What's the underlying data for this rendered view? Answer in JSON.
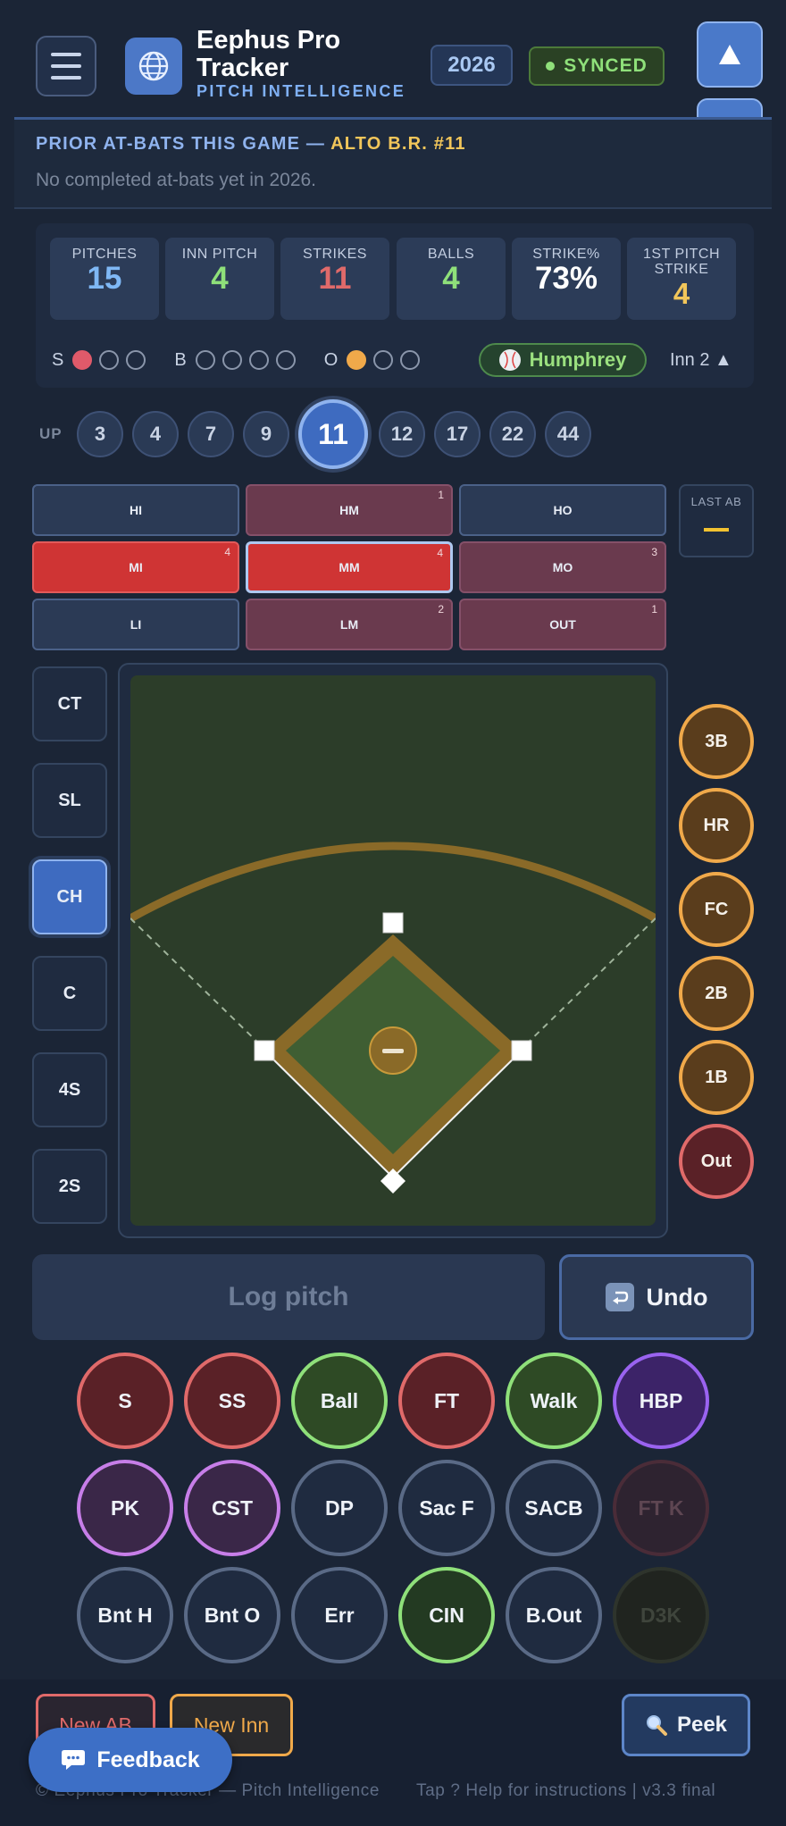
{
  "header": {
    "app_title": "Eephus Pro Tracker",
    "app_subtitle": "PITCH INTELLIGENCE",
    "year": "2026",
    "sync_status": "SYNCED",
    "icons": [
      "menu-icon",
      "globe-icon",
      "arrow-up-icon",
      "arrow-down-icon"
    ]
  },
  "prior": {
    "heading_prefix": "PRIOR AT-BATS THIS GAME —",
    "batter": "ALTO B.R. #11",
    "empty_message": "No completed at-bats yet in 2026."
  },
  "stats": [
    {
      "label": "PITCHES",
      "value": "15",
      "color": "#7fb8f5"
    },
    {
      "label": "INN PITCH",
      "value": "4",
      "color": "#8fe07a"
    },
    {
      "label": "STRIKES",
      "value": "11",
      "color": "#e06a6a"
    },
    {
      "label": "BALLS",
      "value": "4",
      "color": "#8fe07a"
    },
    {
      "label": "STRIKE%",
      "value": "73%",
      "color": "#ffffff"
    },
    {
      "label": "1ST PITCH STRIKE",
      "value": "4",
      "color": "#f2c65a"
    }
  ],
  "count": {
    "strikes_label": "S",
    "strikes": 1,
    "strikes_max": 3,
    "balls_label": "B",
    "balls": 0,
    "balls_max": 4,
    "outs_label": "O",
    "outs": 1,
    "outs_max": 3
  },
  "pitcher": {
    "name": "Humphrey",
    "icon": "baseball-icon"
  },
  "inning": "Inn 2 ▲",
  "lineup": {
    "label": "UP",
    "numbers": [
      "3",
      "4",
      "7",
      "9",
      "11",
      "12",
      "17",
      "22",
      "44"
    ],
    "active": "11"
  },
  "zones": [
    {
      "label": "HI",
      "count": "",
      "heat": "none"
    },
    {
      "label": "HM",
      "count": "1",
      "heat": "med"
    },
    {
      "label": "HO",
      "count": "",
      "heat": "none"
    },
    {
      "label": "MI",
      "count": "4",
      "heat": "hot"
    },
    {
      "label": "MM",
      "count": "4",
      "heat": "hot",
      "selected": true
    },
    {
      "label": "MO",
      "count": "3",
      "heat": "med"
    },
    {
      "label": "LI",
      "count": "",
      "heat": "none"
    },
    {
      "label": "LM",
      "count": "2",
      "heat": "med"
    },
    {
      "label": "OUT",
      "count": "1",
      "heat": "med"
    }
  ],
  "last_ab": {
    "label": "LAST AB",
    "value": "—"
  },
  "pitch_types": [
    {
      "label": "CT"
    },
    {
      "label": "SL"
    },
    {
      "label": "CH",
      "selected": true
    },
    {
      "label": "C"
    },
    {
      "label": "4S"
    },
    {
      "label": "2S"
    }
  ],
  "hit_results": [
    {
      "label": "3B"
    },
    {
      "label": "HR"
    },
    {
      "label": "FC"
    },
    {
      "label": "2B"
    },
    {
      "label": "1B"
    },
    {
      "label": "Out",
      "style": "out"
    }
  ],
  "actions": {
    "log_label": "Log pitch",
    "undo_label": "Undo",
    "undo_icon": "undo-icon"
  },
  "outcomes": [
    [
      {
        "label": "S",
        "style": "red"
      },
      {
        "label": "SS",
        "style": "red"
      },
      {
        "label": "Ball",
        "style": "green"
      },
      {
        "label": "FT",
        "style": "red"
      },
      {
        "label": "Walk",
        "style": "green"
      },
      {
        "label": "HBP",
        "style": "purple"
      }
    ],
    [
      {
        "label": "PK",
        "style": "violet"
      },
      {
        "label": "CST",
        "style": "violet"
      },
      {
        "label": "DP",
        "style": "plain"
      },
      {
        "label": "Sac F",
        "style": "plain"
      },
      {
        "label": "SACB",
        "style": "plain"
      },
      {
        "label": "FT K",
        "style": "dim-red"
      }
    ],
    [
      {
        "label": "Bnt H",
        "style": "plain"
      },
      {
        "label": "Bnt O",
        "style": "plain"
      },
      {
        "label": "Err",
        "style": "plain"
      },
      {
        "label": "CIN",
        "style": "greendark"
      },
      {
        "label": "B.Out",
        "style": "plain"
      },
      {
        "label": "D3K",
        "style": "dim"
      }
    ]
  ],
  "footer": {
    "new_ab": "New AB",
    "new_inn": "New Inn",
    "peek": "Peek",
    "peek_icon": "magnifier-icon",
    "feedback": "Feedback",
    "feedback_icon": "chat-bubble-icon",
    "copyright": "© Eephus Pro Tracker — Pitch Intelligence",
    "help": "Tap ? Help for instructions  |  v3.3 final"
  }
}
